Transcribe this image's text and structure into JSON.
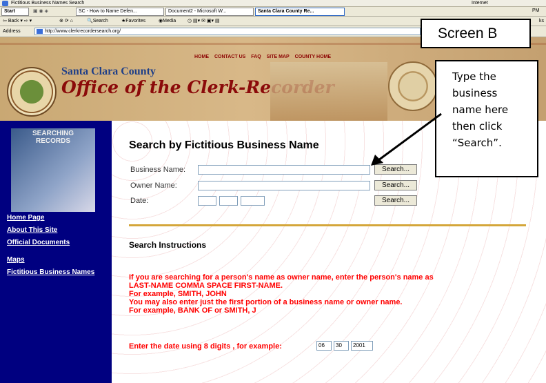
{
  "window": {
    "title": "Fictitious Business Names Search",
    "internet_zone": "Internet",
    "taskbar_time": "PM"
  },
  "taskbar": {
    "start": "Start",
    "buttons": [
      "SC - How to Name Defen...",
      "Document2 - Microsoft W...",
      "Santa Clara County Re..."
    ]
  },
  "toolbar": {
    "back": "Back",
    "search": "Search",
    "favorites": "Favorites",
    "media": "Media",
    "links": "ks"
  },
  "address": {
    "label": "Address",
    "url": "http://www.clerkrecordersearch.org/"
  },
  "banner": {
    "nav": [
      "HOME",
      "CONTACT US",
      "FAQ",
      "SITE MAP",
      "COUNTY HOME"
    ],
    "county": "Santa Clara County",
    "office": "Office of the Clerk-Recorder"
  },
  "annotation": {
    "screen_label": "Screen B",
    "callout": [
      "Type the",
      "business",
      "name here",
      "then click",
      "“Search”."
    ]
  },
  "sidebar": {
    "image_title": [
      "SEARCHING",
      "RECORDS"
    ],
    "links": [
      "Home Page",
      "About This Site",
      "Official Documents",
      "Maps",
      "Fictitious Business Names"
    ]
  },
  "form": {
    "heading": "Search by Fictitious Business Name",
    "business_label": "Business Name:",
    "owner_label": "Owner Name:",
    "date_label": "Date:",
    "search_button": "Search..."
  },
  "instructions": {
    "title": "Search Instructions",
    "lines": [
      "If you are searching for a person's name as owner name, enter the person's name as",
      "LAST-NAME COMMA SPACE FIRST-NAME.",
      "For example, SMITH, JOHN",
      "You may also enter just the first portion of a business name or owner name.",
      "For example, BANK OF or SMITH, J"
    ],
    "date_text": "Enter the date using 8 digits , for example:",
    "date_example": [
      "06",
      "30",
      "2001"
    ]
  }
}
